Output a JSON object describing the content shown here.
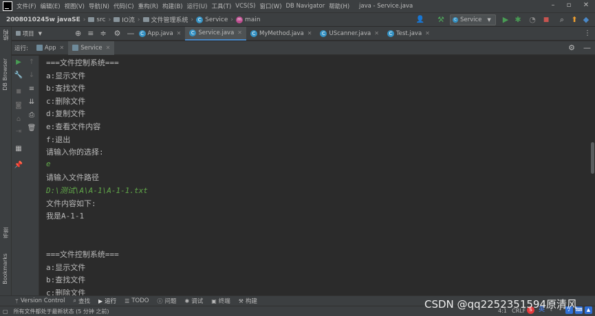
{
  "menu": [
    "文件(F)",
    "编辑(E)",
    "视图(V)",
    "导航(N)",
    "代码(C)",
    "重构(R)",
    "构建(B)",
    "运行(U)",
    "工具(T)",
    "VCS(S)",
    "窗口(W)",
    "DB Navigator",
    "帮助(H)"
  ],
  "window_title": "java - Service.java",
  "breadcrumb": {
    "project": "2008010245w javaSE",
    "src": "src",
    "pkg": "IO流",
    "pkg2": "文件管理系统",
    "cls": "Service",
    "method": "main"
  },
  "run_config": "Service",
  "side_panels": {
    "structure": "结构",
    "db_browser": "DB Browser",
    "bookmarks_cn": "书签",
    "bookmarks": "Bookmarks"
  },
  "project_label": "项目",
  "editor_tabs": [
    {
      "label": "App.java",
      "active": false
    },
    {
      "label": "Service.java",
      "active": true
    },
    {
      "label": "MyMethod.java",
      "active": false
    },
    {
      "label": "UScanner.java",
      "active": false
    },
    {
      "label": "Test.java",
      "active": false
    }
  ],
  "run_panel": {
    "label": "运行:",
    "tabs": [
      "App",
      "Service"
    ]
  },
  "console_lines": [
    {
      "text": "===文件控制系统===",
      "input": false
    },
    {
      "text": "a:显示文件",
      "input": false
    },
    {
      "text": "b:查找文件",
      "input": false
    },
    {
      "text": "c:删除文件",
      "input": false
    },
    {
      "text": "d:复制文件",
      "input": false
    },
    {
      "text": "e:查看文件内容",
      "input": false
    },
    {
      "text": "f:退出",
      "input": false
    },
    {
      "text": "请输入你的选择:",
      "input": false
    },
    {
      "text": "e",
      "input": true
    },
    {
      "text": "请输入文件路径",
      "input": false
    },
    {
      "text": "D:\\测试\\A\\A-1\\A-1-1.txt",
      "input": true
    },
    {
      "text": "文件内容如下:",
      "input": false
    },
    {
      "text": "我是A-1-1",
      "input": false
    },
    {
      "text": "",
      "input": false
    },
    {
      "text": "",
      "input": false
    },
    {
      "text": "===文件控制系统===",
      "input": false
    },
    {
      "text": "a:显示文件",
      "input": false
    },
    {
      "text": "b:查找文件",
      "input": false
    },
    {
      "text": "c:删除文件",
      "input": false
    }
  ],
  "bottom_tools": [
    {
      "label": "Version Control",
      "icon": "branch-icon"
    },
    {
      "label": "查找",
      "icon": "search-icon"
    },
    {
      "label": "运行",
      "icon": "run-icon"
    },
    {
      "label": "TODO",
      "icon": "todo-icon"
    },
    {
      "label": "问题",
      "icon": "problems-icon"
    },
    {
      "label": "调试",
      "icon": "debug-icon"
    },
    {
      "label": "终端",
      "icon": "terminal-icon"
    },
    {
      "label": "构建",
      "icon": "build-icon"
    }
  ],
  "status": {
    "message": "所有文件都处于最新状态 (5 分钟 之前)",
    "position": "4:1",
    "line_sep": "CRLF"
  },
  "watermark": "CSDN @qq2252351594原清风",
  "colors": {
    "accent": "#4a88c7",
    "run_green": "#499c54",
    "input_green": "#62a84a",
    "console_bg": "#2b2b2b",
    "chrome_bg": "#3c3f41"
  }
}
